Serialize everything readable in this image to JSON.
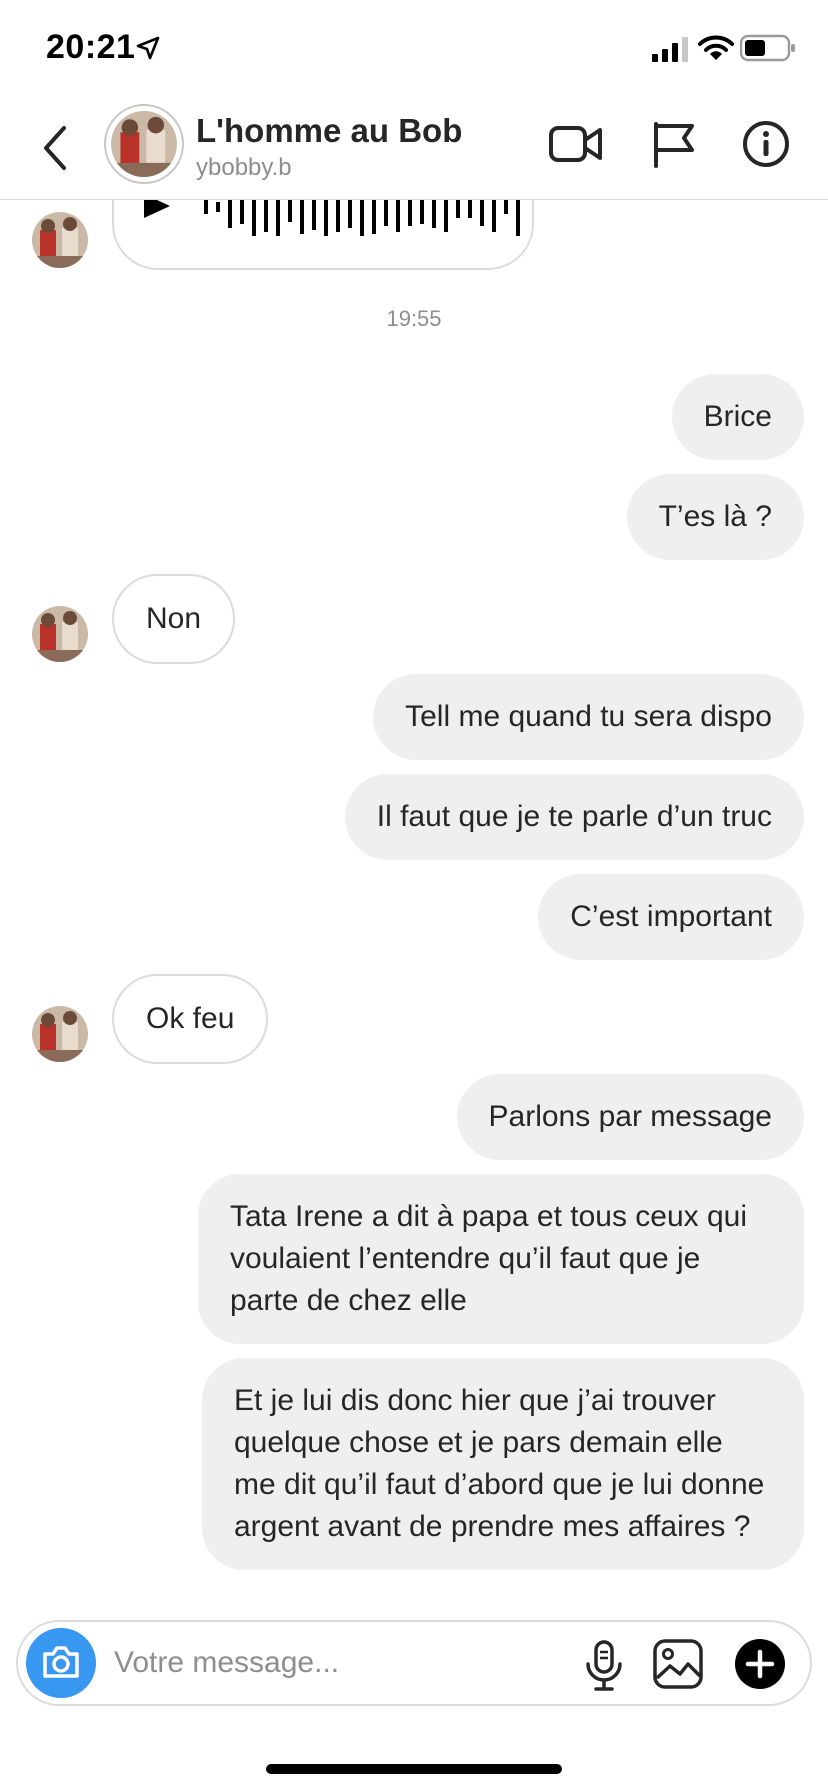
{
  "status_bar": {
    "time": "20:21"
  },
  "header": {
    "contact_name": "L'homme au Bob",
    "username": "ybobby.b"
  },
  "chat": {
    "timestamp": "19:55",
    "messages": [
      {
        "direction": "outgoing",
        "text": "Brice"
      },
      {
        "direction": "outgoing",
        "text": "T’es là ?"
      },
      {
        "direction": "incoming",
        "text": "Non"
      },
      {
        "direction": "outgoing",
        "text": "Tell me quand tu sera dispo"
      },
      {
        "direction": "outgoing",
        "text": "Il faut que je te parle d’un truc"
      },
      {
        "direction": "outgoing",
        "text": "C’est important"
      },
      {
        "direction": "incoming",
        "text": "Ok feu"
      },
      {
        "direction": "outgoing",
        "text": "Parlons par message"
      },
      {
        "direction": "outgoing",
        "text": "Tata Irene a dit à papa et tous ceux qui voulaient l’entendre qu’il faut que je parte de chez elle"
      },
      {
        "direction": "outgoing",
        "text": "Et je lui dis donc hier que j’ai trouver quelque chose et je pars demain elle me dit qu’il faut d’abord que je lui donne argent avant de prendre mes affaires  ?"
      }
    ]
  },
  "composer": {
    "placeholder": "Votre message..."
  },
  "icons": {
    "status": [
      "location-arrow-icon",
      "signal-icon",
      "wifi-icon",
      "battery-icon"
    ],
    "header": [
      "back-icon",
      "video-call-icon",
      "flag-icon",
      "info-icon"
    ],
    "composer": [
      "camera-icon",
      "microphone-icon",
      "gallery-icon",
      "plus-icon"
    ]
  },
  "colors": {
    "accent": "#3897f0",
    "outgoing_bubble": "#efefef",
    "border": "#dbdbdb",
    "muted": "#8e8e8e"
  }
}
